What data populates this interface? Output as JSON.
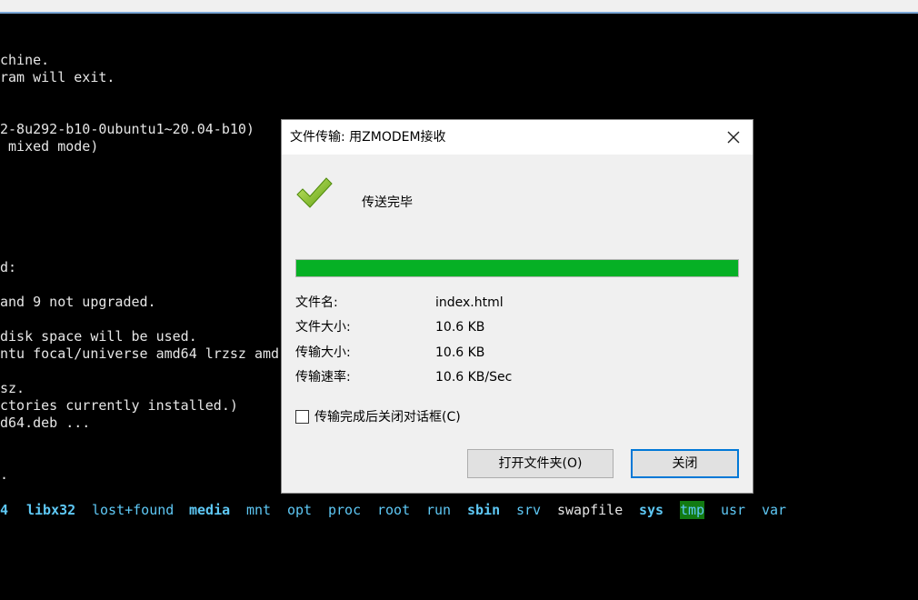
{
  "terminal": {
    "lines": [
      "chine.",
      "ram will exit.",
      "",
      "",
      "2-8u292-b10-0ubuntu1~20.04-b10)",
      " mixed mode)",
      "",
      "",
      "",
      "",
      "",
      "",
      "d:",
      "",
      "and 9 not upgraded.",
      "",
      "disk space will be used.",
      "ntu focal/universe amd64 lrzsz amd",
      "",
      "sz.",
      "ctories currently installed.)",
      "d64.deb ...",
      "",
      "",
      "."
    ],
    "ls_row": [
      {
        "text": "4",
        "style": "dir"
      },
      {
        "text": "libx32",
        "style": "dir"
      },
      {
        "text": "lost+found",
        "style": "dir"
      },
      {
        "text": "media",
        "style": "dir"
      },
      {
        "text": "mnt",
        "style": "dir"
      },
      {
        "text": "opt",
        "style": "dir"
      },
      {
        "text": "proc",
        "style": "dir"
      },
      {
        "text": "root",
        "style": "dir"
      },
      {
        "text": "run",
        "style": "dir"
      },
      {
        "text": "sbin",
        "style": "dir"
      },
      {
        "text": "srv",
        "style": "dir"
      },
      {
        "text": "swapfile",
        "style": "file"
      },
      {
        "text": "sys",
        "style": "dir"
      },
      {
        "text": "tmp",
        "style": "highlight"
      },
      {
        "text": "usr",
        "style": "dir"
      },
      {
        "text": "var",
        "style": "dir"
      }
    ]
  },
  "dialog": {
    "title": "文件传输: 用ZMODEM接收",
    "status": "传送完毕",
    "icons": {
      "check": "check-icon",
      "close": "close-icon"
    },
    "progress_fraction": 1.0,
    "progress_color": "#06b025",
    "info": {
      "filename_label": "文件名:",
      "filename_value": "index.html",
      "filesize_label": "文件大小:",
      "filesize_value": "10.6 KB",
      "transferred_label": "传输大小:",
      "transferred_value": "10.6 KB",
      "rate_label": "传输速率:",
      "rate_value": "10.6 KB/Sec"
    },
    "auto_close_label": "传输完成后关闭对话框(C)",
    "auto_close_checked": false,
    "open_folder_label": "打开文件夹(O)",
    "close_label": "关闭"
  }
}
